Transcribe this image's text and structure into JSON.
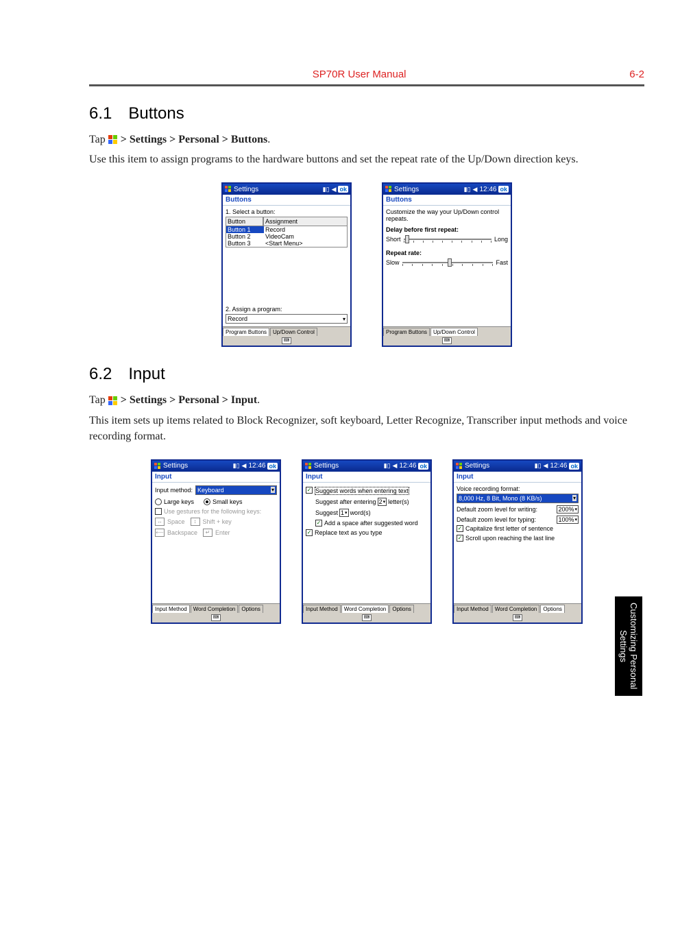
{
  "header": {
    "center": "SP70R User Manual",
    "right": "6-2"
  },
  "sec61": {
    "heading": "6.1 Buttons",
    "tap_prefix": "Tap ",
    "tap_suffix": " > Settings > Personal > Buttons",
    "period": ".",
    "desc": "Use this item to assign programs to the hardware buttons and set the repeat rate of the Up/Down direction keys."
  },
  "pda_common": {
    "title": "Settings",
    "time": "12:46",
    "ok": "ok",
    "tab1": "Program Buttons",
    "tab2": "Up/Down Control",
    "sub_buttons": "Buttons",
    "sub_input": "Input"
  },
  "screen1": {
    "l1": "1. Select a button:",
    "col1": "Button",
    "col2": "Assignment",
    "r1b": "Button 1",
    "r1a": "Record",
    "r2b": "Button 2",
    "r2a": "VideoCam",
    "r3b": "Button 3",
    "r3a": "<Start Menu>",
    "l2": "2. Assign a program:",
    "sel": "Record"
  },
  "screen2": {
    "desc": "Customize the way your Up/Down control repeats.",
    "lab1": "Delay before first repeat:",
    "s1a": "Short",
    "s1b": "Long",
    "lab2": "Repeat rate:",
    "s2a": "Slow",
    "s2b": "Fast"
  },
  "sec62": {
    "heading": "6.2 Input",
    "tap_prefix": "Tap ",
    "tap_suffix": " > Settings > Personal > Input",
    "period": ".",
    "desc": "This item sets up items related to Block Recognizer, soft keyboard, Letter Recognize, Transcriber input methods and voice recording format."
  },
  "screenA": {
    "im": "Input method:",
    "im_val": "Keyboard",
    "large": "Large keys",
    "small": "Small keys",
    "gest": "Use gestures for the following keys:",
    "g1": "Space",
    "g2": "Shift + key",
    "g3": "Backspace",
    "g4": "Enter",
    "t1": "Input Method",
    "t2": "Word Completion",
    "t3": "Options"
  },
  "screenB": {
    "c1": "Suggest words when entering text",
    "l2a": "Suggest after entering",
    "l2b": "2",
    "l2c": "letter(s)",
    "l3a": "Suggest",
    "l3b": "1",
    "l3c": "word(s)",
    "c4": "Add a space after suggested word",
    "c5": "Replace text as you type"
  },
  "screenC": {
    "l1": "Voice recording format:",
    "v1": "8,000 Hz, 8 Bit, Mono (8 KB/s)",
    "l2": "Default zoom level for writing:",
    "v2": "200%",
    "l3": "Default zoom level for typing:",
    "v3": "100%",
    "c4": "Capitalize first letter of sentence",
    "c5": "Scroll upon reaching the last line"
  },
  "sidetab": "Customizing Personal Settings"
}
